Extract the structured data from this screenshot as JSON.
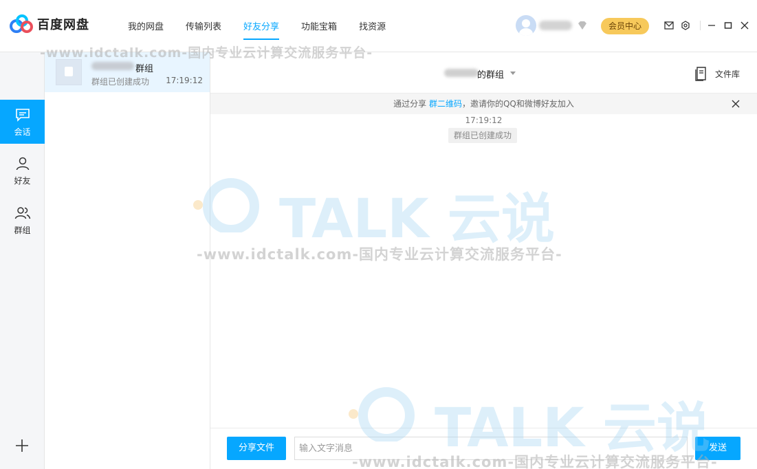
{
  "app": {
    "name": "百度网盘",
    "accent": "#06a7ff",
    "vip_color": "#f7c95b"
  },
  "nav": {
    "items": [
      {
        "label": "我的网盘"
      },
      {
        "label": "传输列表"
      },
      {
        "label": "好友分享",
        "active": true
      },
      {
        "label": "功能宝箱"
      },
      {
        "label": "找资源"
      }
    ]
  },
  "user": {
    "vip_button": "会员中心"
  },
  "sidebar": {
    "items": [
      {
        "label": "会话",
        "icon": "chat-icon",
        "active": true
      },
      {
        "label": "好友",
        "icon": "person-icon"
      },
      {
        "label": "群组",
        "icon": "group-icon"
      }
    ]
  },
  "conversations": [
    {
      "name_suffix": "群组",
      "last_message": "群组已创建成功",
      "time": "17:19:12"
    }
  ],
  "chat": {
    "title_suffix": "的群组",
    "file_library": "文件库",
    "notice": {
      "prefix": "通过分享 ",
      "link": "群二维码",
      "suffix": "，邀请你的QQ和微博好友加入"
    },
    "messages": [
      {
        "time": "17:19:12",
        "system_text": "群组已创建成功"
      }
    ],
    "compose": {
      "share_button": "分享文件",
      "input_placeholder": "输入文字消息",
      "send_button": "发送"
    }
  },
  "watermark": {
    "brand": "TALK 云说",
    "url": "-www.idctalk.com-国内专业云计算交流服务平台-"
  }
}
